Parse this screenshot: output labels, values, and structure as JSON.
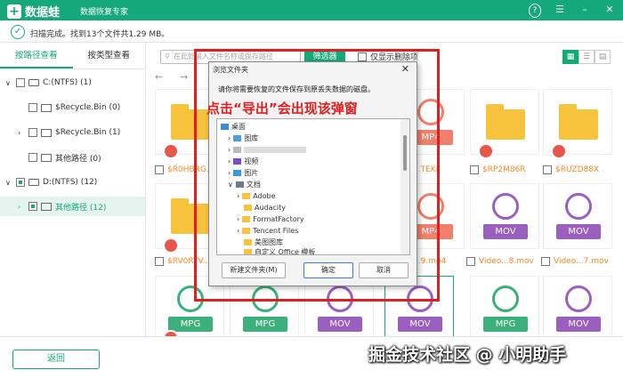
{
  "app": {
    "name": "数据蛙",
    "subtitle": "数据恢复专家"
  },
  "status": {
    "text": "扫描完成。找到13个文件共1.29 MB。"
  },
  "sidebar": {
    "tabs": [
      {
        "label": "按路径查看"
      },
      {
        "label": "按类型查看"
      }
    ],
    "tree": [
      {
        "label": "C:(NTFS) (1)"
      },
      {
        "label": "$Recycle.Bin (0)"
      },
      {
        "label": "$Recycle.Bin (1)"
      },
      {
        "label": "其他路径 (0)"
      },
      {
        "label": "D:(NTFS) (12)"
      },
      {
        "label": "其他路径 (12)"
      }
    ]
  },
  "toolbar": {
    "search_placeholder": "在此处输入文件名称或保存路径",
    "filter_label": "筛选器",
    "only_deleted_label": "仅显示删除项"
  },
  "grid": {
    "cards": [
      {
        "type": "folder",
        "caption": "$R0HBRG..."
      },
      {
        "type": "video",
        "badge": "MP4",
        "caption": "...TEKF"
      },
      {
        "type": "folder",
        "caption": "$RP2M86R"
      },
      {
        "type": "folder",
        "caption": "$RUZD88X"
      },
      {
        "type": "folder",
        "caption": "$RV0RYV..."
      },
      {
        "type": "video",
        "badge": "MP4",
        "caption": "...9.mp4"
      },
      {
        "type": "video",
        "badge": "MOV",
        "caption": "Video...8.mov"
      },
      {
        "type": "video",
        "badge": "MOV",
        "caption": "Video...7.mov"
      },
      {
        "type": "video",
        "badge": "MPG",
        "caption": ""
      },
      {
        "type": "video",
        "badge": "MPG",
        "caption": ""
      },
      {
        "type": "video",
        "badge": "MOV",
        "caption": ""
      },
      {
        "type": "video",
        "badge": "MOV",
        "caption": ""
      },
      {
        "type": "video",
        "badge": "MPG",
        "caption": ""
      },
      {
        "type": "video",
        "badge": "MOV",
        "caption": ""
      }
    ]
  },
  "bottom": {
    "back_label": "返回"
  },
  "dialog": {
    "title": "浏览文件夹",
    "close": "✕",
    "message": "请你将需要恢复的文件保存到原丢失数据的磁盘。",
    "tree": [
      {
        "label": "桌面"
      },
      {
        "label": "图库"
      },
      {
        "label": "视频"
      },
      {
        "label": "图片"
      },
      {
        "label": "文档"
      },
      {
        "label": "Adobe"
      },
      {
        "label": "Audacity"
      },
      {
        "label": "FormatFactory"
      },
      {
        "label": "Tencent Files"
      },
      {
        "label": "美图图库"
      },
      {
        "label": "自定义 Office 模板"
      }
    ],
    "new_folder_label": "新建文件夹(M)",
    "ok_label": "确定",
    "cancel_label": "取消"
  },
  "annotation": {
    "text": "点击“导出”会出现该弹窗"
  },
  "watermark": {
    "text": "掘金技术社区 @ 小明助手"
  },
  "colors": {
    "brand": "#14a87a",
    "folder": "#f8c33c",
    "annotation": "#e02020",
    "mp4": "#f07f6b",
    "mov": "#9b5fc0",
    "mpg": "#3bb07a"
  }
}
